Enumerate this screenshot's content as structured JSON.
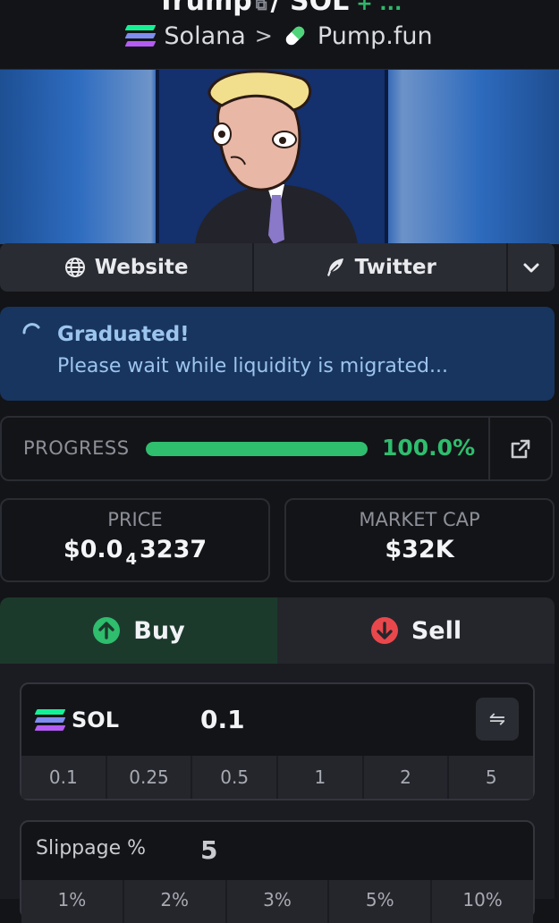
{
  "header": {
    "pair_base": "Trump",
    "pair_sep": "/",
    "pair_quote": "SOL",
    "pair_change": "+ ...",
    "chain": "Solana",
    "breadcrumb_sep": ">",
    "launchpad": "Pump.fun"
  },
  "links": {
    "website": "Website",
    "twitter": "Twitter"
  },
  "status": {
    "title": "Graduated!",
    "message": "Please wait while liquidity is migrated..."
  },
  "progress": {
    "label": "PROGRESS",
    "value_text": "100.0%",
    "fraction": 1.0
  },
  "stats": {
    "price_label": "PRICE",
    "price_prefix": "$0.0",
    "price_zeros": "4",
    "price_digits": "3237",
    "mcap_label": "MARKET CAP",
    "mcap_value": "$32K"
  },
  "trade": {
    "buy_label": "Buy",
    "sell_label": "Sell",
    "token": "SOL",
    "amount": "0.1",
    "swap_icon": "⇋",
    "quick_amounts": [
      "0.1",
      "0.25",
      "0.5",
      "1",
      "2",
      "5"
    ],
    "slippage_label": "Slippage %",
    "slippage_value": "5",
    "slippage_options": [
      "1%",
      "2%",
      "3%",
      "5%",
      "10%"
    ]
  },
  "colors": {
    "accent_green": "#2fbd6e",
    "sell_red": "#e8484c",
    "status_blue": "#18355f",
    "background": "#131417"
  },
  "icons": {
    "chain_logo": "solana-logo-icon",
    "launchpad_logo": "pill-icon",
    "website": "globe-icon",
    "twitter": "feather-icon",
    "more": "chevron-down-icon",
    "status": "spinner-icon",
    "external": "external-link-icon",
    "buy": "arrow-up-circle-icon",
    "sell": "arrow-down-circle-icon"
  }
}
